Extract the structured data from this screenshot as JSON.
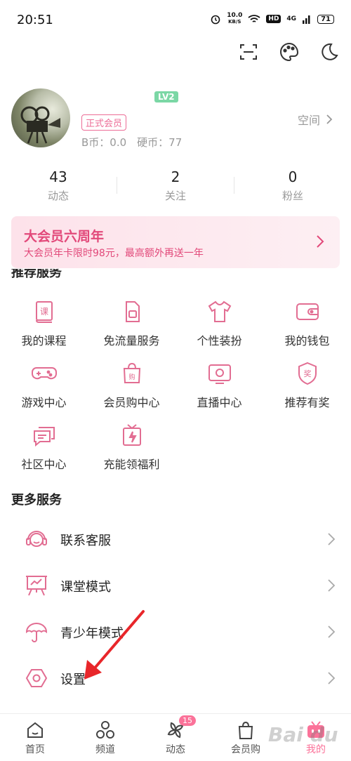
{
  "status_bar": {
    "time": "20:51",
    "net_speed_top": "10.0",
    "net_speed_unit": "KB/S",
    "hd": "HD",
    "signal": "4G",
    "battery": "71"
  },
  "profile": {
    "level": "LV2",
    "vip_tag": "正式会员",
    "coins": "B币：0.0　硬币：77",
    "space_link": "空间"
  },
  "stats": [
    {
      "value": "43",
      "label": "动态"
    },
    {
      "value": "2",
      "label": "关注"
    },
    {
      "value": "0",
      "label": "粉丝"
    }
  ],
  "banner": {
    "title": "大会员六周年",
    "subtitle": "大会员年卡限时98元，最高额外再送一年"
  },
  "recommended": {
    "title": "推荐服务",
    "items": [
      {
        "label": "我的课程",
        "icon": "course-icon"
      },
      {
        "label": "免流量服务",
        "icon": "sim-card-icon"
      },
      {
        "label": "个性装扮",
        "icon": "tshirt-icon"
      },
      {
        "label": "我的钱包",
        "icon": "wallet-icon"
      },
      {
        "label": "游戏中心",
        "icon": "gamepad-icon"
      },
      {
        "label": "会员购中心",
        "icon": "shopping-bag-icon"
      },
      {
        "label": "直播中心",
        "icon": "live-tv-icon"
      },
      {
        "label": "推荐有奖",
        "icon": "reward-badge-icon"
      },
      {
        "label": "社区中心",
        "icon": "chat-bubbles-icon"
      },
      {
        "label": "充能领福利",
        "icon": "gift-bolt-icon"
      }
    ]
  },
  "more": {
    "title": "更多服务",
    "items": [
      {
        "label": "联系客服",
        "icon": "headset-icon"
      },
      {
        "label": "课堂模式",
        "icon": "classroom-icon"
      },
      {
        "label": "青少年模式",
        "icon": "umbrella-icon"
      },
      {
        "label": "设置",
        "icon": "settings-icon"
      }
    ]
  },
  "bottom_nav": [
    {
      "label": "首页",
      "icon": "home-icon"
    },
    {
      "label": "频道",
      "icon": "channel-icon"
    },
    {
      "label": "动态",
      "icon": "pinwheel-icon",
      "badge": "15"
    },
    {
      "label": "会员购",
      "icon": "shopping-bag-icon"
    },
    {
      "label": "我的",
      "icon": "tv-face-icon"
    }
  ],
  "watermark": "Bai du",
  "colors": {
    "accent": "#fb7299",
    "icon_pink": "#e26d92",
    "banner_text": "#e2497a",
    "arrow": "#e8262a"
  }
}
